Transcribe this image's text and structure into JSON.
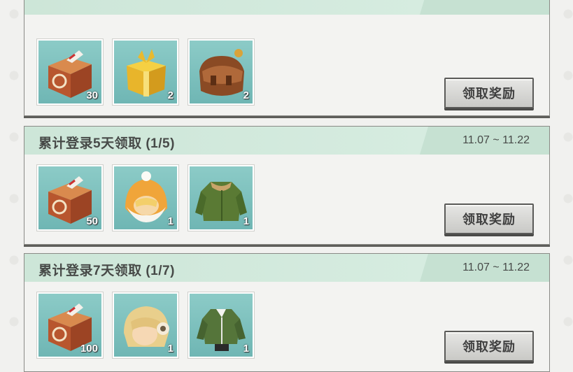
{
  "cards": [
    {
      "title": "",
      "date": "",
      "button_label": "领取奖励",
      "items": [
        {
          "icon": "gift-chest-icon",
          "qty": "30"
        },
        {
          "icon": "golden-giftbox-icon",
          "qty": "2"
        },
        {
          "icon": "leather-bag-icon",
          "qty": "2"
        }
      ]
    },
    {
      "title": "累计登录5天领取 (1/5)",
      "date": "11.07 ~ 11.22",
      "button_label": "领取奖励",
      "items": [
        {
          "icon": "gift-chest-icon",
          "qty": "50"
        },
        {
          "icon": "winter-hood-hat-icon",
          "qty": "1"
        },
        {
          "icon": "green-coat-icon",
          "qty": "1"
        }
      ]
    },
    {
      "title": "累计登录7天领取 (1/7)",
      "date": "11.07 ~ 11.22",
      "button_label": "领取奖励",
      "items": [
        {
          "icon": "gift-chest-icon",
          "qty": "100"
        },
        {
          "icon": "blonde-wig-hat-icon",
          "qty": "1"
        },
        {
          "icon": "green-jacket-icon",
          "qty": "1"
        }
      ]
    }
  ],
  "colors": {
    "header": "#cde6d8",
    "item_bg": "#7fc1be",
    "button": "#d6d6d4",
    "text": "#474a48"
  }
}
